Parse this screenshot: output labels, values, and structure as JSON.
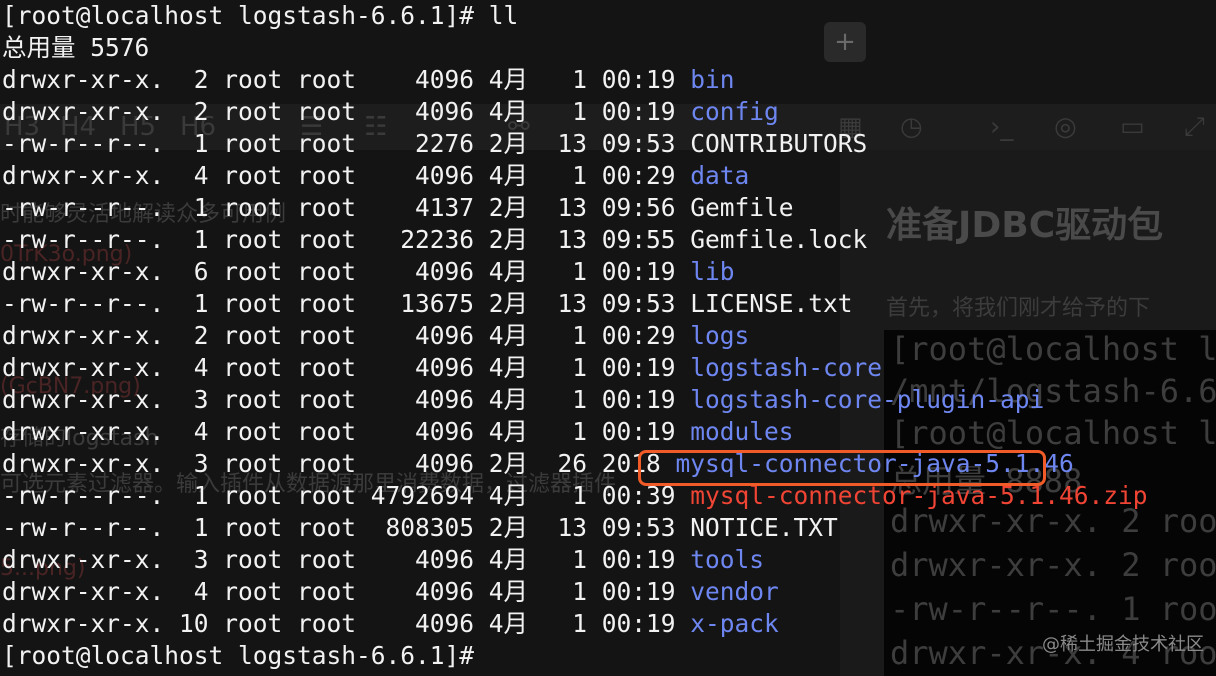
{
  "terminal": {
    "prompt_command": "[root@localhost logstash-6.6.1]# ll",
    "total_line": "总用量 5576",
    "final_prompt": "[root@localhost logstash-6.6.1]#",
    "entries": [
      {
        "perms": "drwxr-xr-x.",
        "links": " 2",
        "owner": "root",
        "group": "root",
        "size": "   4096",
        "month": "4月",
        "day": "  1",
        "time": "00:19",
        "name": "bin",
        "type": "dir"
      },
      {
        "perms": "drwxr-xr-x.",
        "links": " 2",
        "owner": "root",
        "group": "root",
        "size": "   4096",
        "month": "4月",
        "day": "  1",
        "time": "00:19",
        "name": "config",
        "type": "dir"
      },
      {
        "perms": "-rw-r--r--.",
        "links": " 1",
        "owner": "root",
        "group": "root",
        "size": "   2276",
        "month": "2月",
        "day": " 13",
        "time": "09:53",
        "name": "CONTRIBUTORS",
        "type": "file"
      },
      {
        "perms": "drwxr-xr-x.",
        "links": " 4",
        "owner": "root",
        "group": "root",
        "size": "   4096",
        "month": "4月",
        "day": "  1",
        "time": "00:29",
        "name": "data",
        "type": "dir"
      },
      {
        "perms": "-rw-r--r--.",
        "links": " 1",
        "owner": "root",
        "group": "root",
        "size": "   4137",
        "month": "2月",
        "day": " 13",
        "time": "09:56",
        "name": "Gemfile",
        "type": "file"
      },
      {
        "perms": "-rw-r--r--.",
        "links": " 1",
        "owner": "root",
        "group": "root",
        "size": "  22236",
        "month": "2月",
        "day": " 13",
        "time": "09:55",
        "name": "Gemfile.lock",
        "type": "file"
      },
      {
        "perms": "drwxr-xr-x.",
        "links": " 6",
        "owner": "root",
        "group": "root",
        "size": "   4096",
        "month": "4月",
        "day": "  1",
        "time": "00:19",
        "name": "lib",
        "type": "dir"
      },
      {
        "perms": "-rw-r--r--.",
        "links": " 1",
        "owner": "root",
        "group": "root",
        "size": "  13675",
        "month": "2月",
        "day": " 13",
        "time": "09:53",
        "name": "LICENSE.txt",
        "type": "file"
      },
      {
        "perms": "drwxr-xr-x.",
        "links": " 2",
        "owner": "root",
        "group": "root",
        "size": "   4096",
        "month": "4月",
        "day": "  1",
        "time": "00:29",
        "name": "logs",
        "type": "dir"
      },
      {
        "perms": "drwxr-xr-x.",
        "links": " 4",
        "owner": "root",
        "group": "root",
        "size": "   4096",
        "month": "4月",
        "day": "  1",
        "time": "00:19",
        "name": "logstash-core",
        "type": "dir"
      },
      {
        "perms": "drwxr-xr-x.",
        "links": " 3",
        "owner": "root",
        "group": "root",
        "size": "   4096",
        "month": "4月",
        "day": "  1",
        "time": "00:19",
        "name": "logstash-core-plugin-api",
        "type": "dir"
      },
      {
        "perms": "drwxr-xr-x.",
        "links": " 4",
        "owner": "root",
        "group": "root",
        "size": "   4096",
        "month": "4月",
        "day": "  1",
        "time": "00:19",
        "name": "modules",
        "type": "dir"
      },
      {
        "perms": "drwxr-xr-x.",
        "links": " 3",
        "owner": "root",
        "group": "root",
        "size": "   4096",
        "month": "2月",
        "day": " 26",
        "time": "2018",
        "name": "mysql-connector-java-5.1.46",
        "type": "dir"
      },
      {
        "perms": "-rw-r--r--.",
        "links": " 1",
        "owner": "root",
        "group": "root",
        "size": "4792694",
        "month": "4月",
        "day": "  1",
        "time": "00:39",
        "name": "mysql-connector-java-5.1.46.zip",
        "type": "zip"
      },
      {
        "perms": "-rw-r--r--.",
        "links": " 1",
        "owner": "root",
        "group": "root",
        "size": " 808305",
        "month": "2月",
        "day": " 13",
        "time": "09:53",
        "name": "NOTICE.TXT",
        "type": "file"
      },
      {
        "perms": "drwxr-xr-x.",
        "links": " 3",
        "owner": "root",
        "group": "root",
        "size": "   4096",
        "month": "4月",
        "day": "  1",
        "time": "00:19",
        "name": "tools",
        "type": "dir"
      },
      {
        "perms": "drwxr-xr-x.",
        "links": " 4",
        "owner": "root",
        "group": "root",
        "size": "   4096",
        "month": "4月",
        "day": "  1",
        "time": "00:19",
        "name": "vendor",
        "type": "dir"
      },
      {
        "perms": "drwxr-xr-x.",
        "links": "10",
        "owner": "root",
        "group": "root",
        "size": "   4096",
        "month": "4月",
        "day": "  1",
        "time": "00:19",
        "name": "x-pack",
        "type": "dir"
      }
    ],
    "colors": {
      "dir": "#6e86f0",
      "zip": "#f04434",
      "file": "#f2f2f2",
      "highlight": "#f05b28",
      "background": "#0b0b0b"
    }
  },
  "background_editor": {
    "toolbar_left_items": [
      "H3",
      "H4",
      "H5",
      "H6"
    ],
    "toolbar_icons": [
      "bullet-list-icon",
      "numbered-list-icon",
      "link-icon",
      "table-icon",
      "clock-icon",
      "terminal-icon",
      "eye-off-icon",
      "monitor-icon",
      "expand-icon"
    ],
    "add_button_label": "+",
    "left_fragments": [
      "时能够灵活地解读众多可用例",
      "0TrK3o.png)",
      "(GcBN7.png)",
      "存储的logstash",
      "可选元素过滤器。输入插件从数据源那里消费数据，过滤器插件",
      "5...png)"
    ],
    "heading": "准备JDBC驱动包",
    "paragraph": "首先，将我们刚才给予的下",
    "code_lines": [
      "[root@localhost lo",
      "/mnt/logstash-6.6",
      "[root@localhost lo",
      "总用量 8888",
      "drwxr-xr-x.  2 roo",
      "drwxr-xr-x.  2 roo",
      "-rw-r--r--.  1 roo",
      "drwxr-xr-x.  4 roo"
    ],
    "watermark": "@稀土掘金技术社区"
  }
}
